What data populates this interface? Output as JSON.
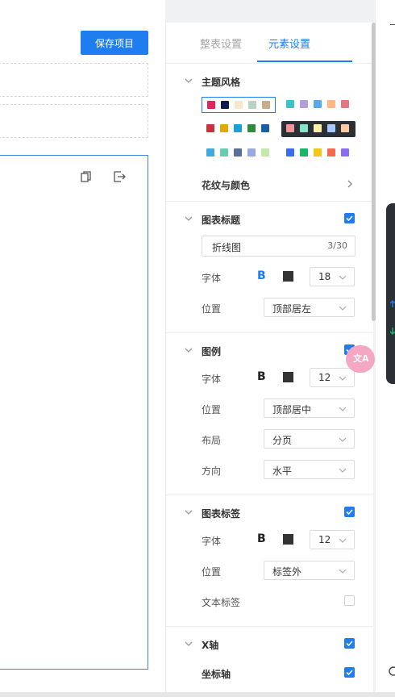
{
  "toolbar": {
    "save_label": "保存项目"
  },
  "tabs": [
    {
      "label": "整表设置",
      "active": false
    },
    {
      "label": "元素设置",
      "active": true
    }
  ],
  "accent_color": "#1f7df0",
  "theme": {
    "title": "主题风格",
    "palettes": [
      {
        "colors": [
          "#e2245a",
          "#0e1a4a",
          "#f5e6cc",
          "#b9d3c2",
          "#c8ac8c"
        ],
        "selected": true,
        "dark": false
      },
      {
        "colors": [
          "#3ec2c7",
          "#b39ddb",
          "#5aa9e6",
          "#ffb787",
          "#e07a80"
        ],
        "selected": false,
        "dark": false
      },
      {
        "colors": [
          "#c8323c",
          "#e2a900",
          "#1a9fdc",
          "#2e8b3c",
          "#1a5ea8"
        ],
        "selected": false,
        "dark": false
      },
      {
        "colors": [
          "#f7929a",
          "#7ee8c8",
          "#fff2a0",
          "#a5c8ff",
          "#ffc9a0"
        ],
        "selected": false,
        "dark": true
      },
      {
        "colors": [
          "#3fa9e0",
          "#66cdb0",
          "#5b6f99",
          "#9aa7e6",
          "#c3e8a8"
        ],
        "selected": false,
        "dark": false
      },
      {
        "colors": [
          "#3b6df0",
          "#19b66a",
          "#f5c518",
          "#f56a4f",
          "#8b6cf0"
        ],
        "selected": false,
        "dark": false
      }
    ],
    "pattern_label": "花纹与颜色"
  },
  "chart_title": {
    "title": "图表标题",
    "checked": true,
    "input_value": "折线图",
    "counter": "3/30",
    "font_label": "字体",
    "font_size": "18",
    "position_label": "位置",
    "position_value": "顶部居左"
  },
  "legend": {
    "title": "图例",
    "checked": true,
    "font_label": "字体",
    "font_size": "12",
    "position_label": "位置",
    "position_value": "顶部居中",
    "layout_label": "布局",
    "layout_value": "分页",
    "direction_label": "方向",
    "direction_value": "水平"
  },
  "chart_label": {
    "title": "图表标签",
    "checked": true,
    "font_label": "字体",
    "font_size": "12",
    "position_label": "位置",
    "position_value": "标签外",
    "text_label": "文本标签",
    "text_checked": false
  },
  "x_axis": {
    "title": "X轴",
    "checked": true,
    "axis_label": "坐标轴",
    "axis_checked": true
  },
  "bold_glyph": "B",
  "translate_glyph": "文A"
}
